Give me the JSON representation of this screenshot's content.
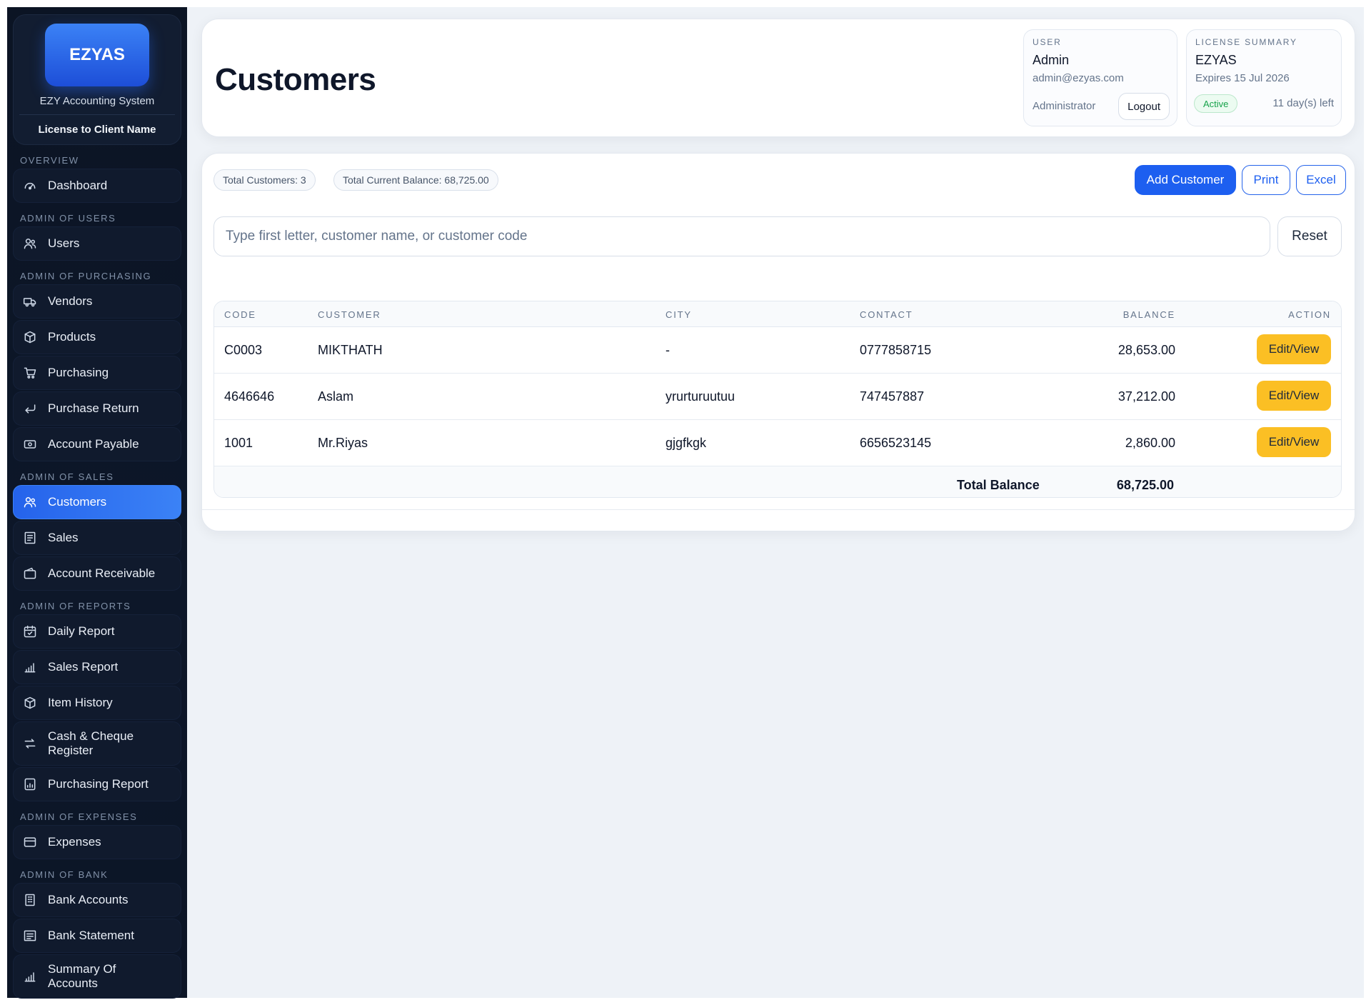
{
  "sidebar": {
    "logo": "EZYAS",
    "subtitle": "EZY Accounting System",
    "license": "License to Client Name",
    "sections": {
      "overview": "OVERVIEW",
      "users": "ADMIN OF USERS",
      "purchasing": "ADMIN OF PURCHASING",
      "sales": "ADMIN OF SALES",
      "reports": "ADMIN OF REPORTS",
      "expenses": "ADMIN OF EXPENSES",
      "bank": "ADMIN OF BANK"
    },
    "items": {
      "dashboard": "Dashboard",
      "users": "Users",
      "vendors": "Vendors",
      "products": "Products",
      "purchasing": "Purchasing",
      "purchase_return": "Purchase Return",
      "account_payable": "Account Payable",
      "customers": "Customers",
      "sales": "Sales",
      "account_receivable": "Account Receivable",
      "daily_report": "Daily Report",
      "sales_report": "Sales Report",
      "item_history": "Item History",
      "cash_cheque_1": "Cash & Cheque",
      "cash_cheque_2": "Register",
      "purchasing_report": "Purchasing Report",
      "expenses": "Expenses",
      "bank_accounts": "Bank Accounts",
      "bank_statement": "Bank Statement",
      "summary_1": "Summary Of",
      "summary_2": "Accounts"
    }
  },
  "header": {
    "title": "Customers",
    "user": {
      "label": "USER",
      "name": "Admin",
      "email": "admin@ezyas.com",
      "role": "Administrator",
      "logout": "Logout"
    },
    "license": {
      "label": "LICENSE SUMMARY",
      "name": "EZYAS",
      "expires": "Expires 15 Jul 2026",
      "status": "Active",
      "days_left": "11 day(s) left"
    }
  },
  "toolbar": {
    "total_customers": "Total Customers: 3",
    "total_balance": "Total Current Balance: 68,725.00",
    "add": "Add Customer",
    "print": "Print",
    "excel": "Excel"
  },
  "search": {
    "placeholder": "Type first letter, customer name, or customer code",
    "reset": "Reset"
  },
  "table": {
    "columns": [
      "CODE",
      "CUSTOMER",
      "CITY",
      "CONTACT",
      "BALANCE",
      "ACTION"
    ],
    "rows": [
      {
        "code": "C0003",
        "customer": "MIKTHATH",
        "city": "-",
        "contact": "0777858715",
        "balance": "28,653.00",
        "action": "Edit/View"
      },
      {
        "code": "4646646",
        "customer": "Aslam",
        "city": "yrurturuutuu",
        "contact": "747457887",
        "balance": "37,212.00",
        "action": "Edit/View"
      },
      {
        "code": "1001",
        "customer": "Mr.Riyas",
        "city": "gjgfkgk",
        "contact": "6656523145",
        "balance": "2,860.00",
        "action": "Edit/View"
      }
    ],
    "footer": {
      "label": "Total Balance",
      "value": "68,725.00"
    }
  },
  "colors": {
    "accent": "#2563eb",
    "sidebar": "#0b1424",
    "edit": "#fbbf24",
    "active": "#16a34a"
  }
}
